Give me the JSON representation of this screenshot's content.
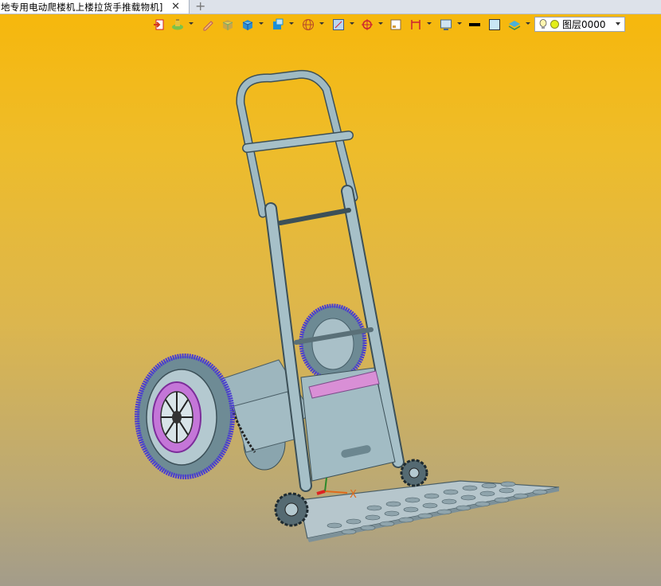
{
  "tab": {
    "title": "地专用电动爬楼机上楼拉货手推载物机]",
    "close_glyph": "✕",
    "new_tab_glyph": "+"
  },
  "toolbar": {
    "tools": [
      "exit-sketch-icon",
      "solid-style-icon",
      "pencil-icon",
      "box-shaded-icon",
      "box-solid-icon",
      "view-orient-icon",
      "sphere-wire-icon",
      "frame-icon",
      "crosshair-icon",
      "small-square-icon",
      "dimension-icon",
      "display-icon",
      "black-line-icon",
      "fill-color-icon",
      "layer-stack-icon"
    ]
  },
  "layer": {
    "current": "图层0000",
    "bulb_color": "#fff6b0",
    "dot_color": "#e3ef1a"
  },
  "model": {
    "frame_color": "#8ab2be",
    "tire_color": "#4a3cd0",
    "hub_color": "#d36de8",
    "axis_labels": {
      "x": "X"
    }
  }
}
